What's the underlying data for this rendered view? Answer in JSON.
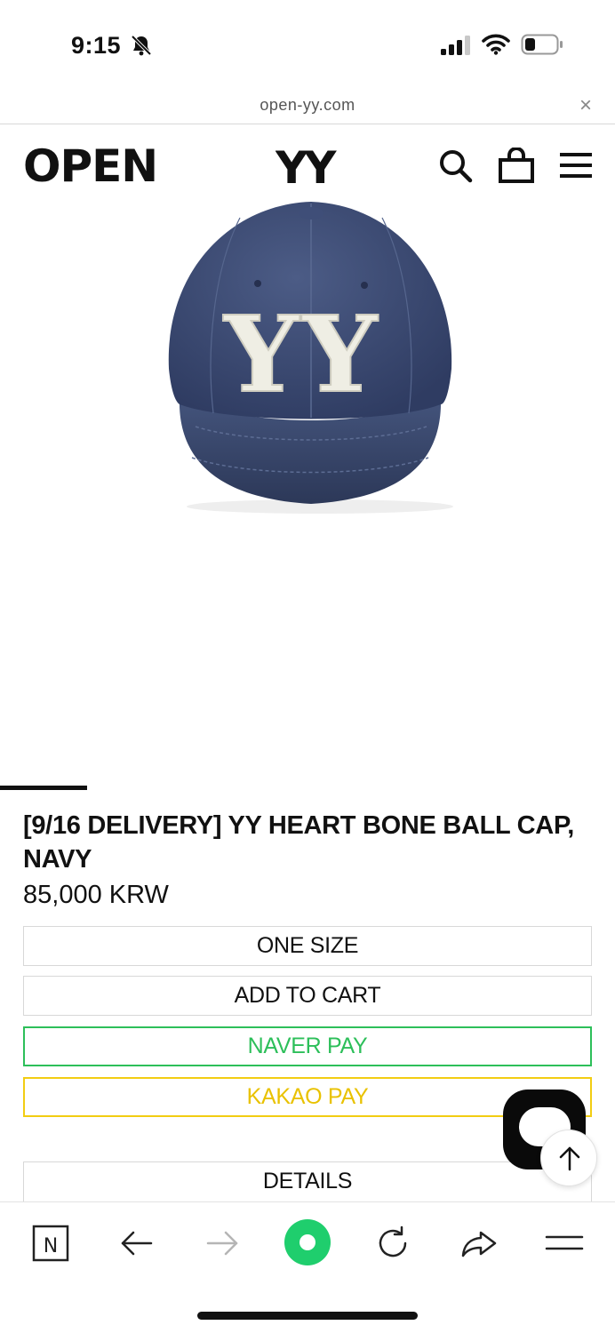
{
  "status_bar": {
    "time": "9:15",
    "icons": [
      "bell-slash-icon",
      "cellular-signal-icon",
      "wifi-icon",
      "battery-icon"
    ]
  },
  "browser": {
    "url": "open-yy.com",
    "close_label": "×"
  },
  "header": {
    "logo_left": "OPEN",
    "logo_center": "YY",
    "icons": [
      "search-icon",
      "shopping-bag-icon",
      "hamburger-menu-icon"
    ]
  },
  "product": {
    "title": "[9/16 DELIVERY] YY HEART BONE BALL CAP, NAVY",
    "price": "85,000 KRW",
    "image_logo_text": "YY",
    "size_option": "ONE SIZE",
    "add_to_cart": "ADD TO CART",
    "naver_pay": "NAVER PAY",
    "kakao_pay": "KAKAO PAY",
    "details": "DETAILS"
  },
  "colors": {
    "accent": "#111111",
    "naver_green": "#2dbf5a",
    "kakao_yellow": "#f2cd12",
    "cap_navy": "#3b4a72",
    "toolbar_green": "#1fce6d"
  },
  "toolbar": {
    "home_badge": "N",
    "icons": [
      "naver-home-icon",
      "back-arrow-icon",
      "forward-arrow-icon",
      "green-dot-icon",
      "reload-icon",
      "share-icon",
      "menu-icon"
    ]
  }
}
